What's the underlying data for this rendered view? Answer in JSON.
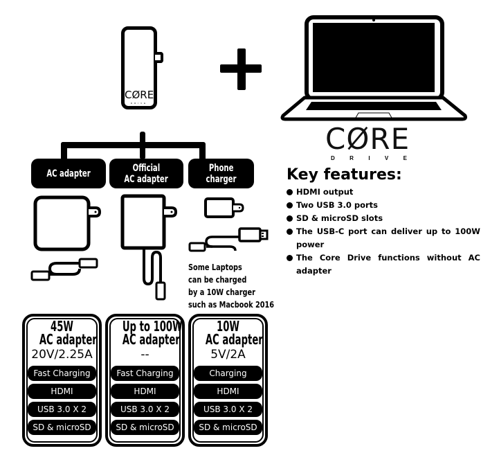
{
  "hub": {
    "logo": "CØRE",
    "logo_sub": "DRIVE"
  },
  "laptop_logo": {
    "main": "CØRE",
    "sub": [
      "D",
      "R",
      "I",
      "V",
      "E"
    ]
  },
  "key_features": {
    "title": "Key features:",
    "items": [
      "HDMI output",
      "Two USB 3.0 ports",
      "SD & microSD slots",
      "The USB-C port can deliver up to 100W power",
      "The Core Drive functions without AC adapter"
    ]
  },
  "sources": [
    {
      "lines": [
        "AC adapter"
      ]
    },
    {
      "lines": [
        "Official",
        "AC adapter"
      ]
    },
    {
      "lines": [
        "Phone",
        "charger"
      ]
    }
  ],
  "note": [
    "Some Laptops",
    "can be charged",
    "by a 10W charger",
    "such as Macbook 2016"
  ],
  "cards": [
    {
      "title": [
        "45W",
        "AC adapter"
      ],
      "volt": "20V/2.25A",
      "features": [
        "Fast Charging",
        "HDMI",
        "USB 3.0 X 2",
        "SD & microSD"
      ]
    },
    {
      "title": [
        "Up to 100W",
        "AC adapter"
      ],
      "volt": "--",
      "features": [
        "Fast Charging",
        "HDMI",
        "USB 3.0 X 2",
        "SD & microSD"
      ]
    },
    {
      "title": [
        "10W",
        "AC adapter"
      ],
      "volt": "5V/2A",
      "features": [
        "Charging",
        "HDMI",
        "USB 3.0 X 2",
        "SD & microSD"
      ]
    }
  ]
}
